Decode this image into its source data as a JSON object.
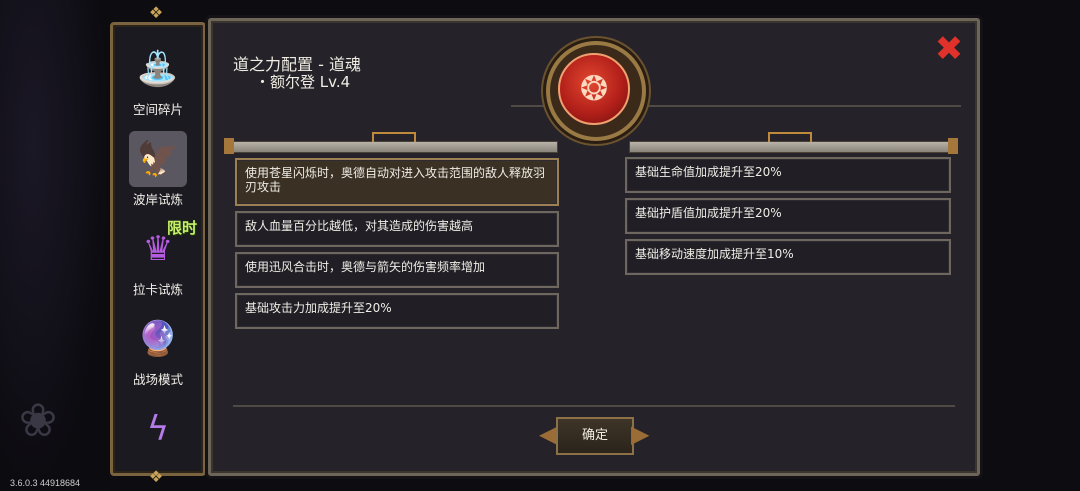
{
  "version": "3.6.0.3 44918684",
  "sidebar": {
    "items": [
      {
        "label": "空间碎片",
        "icon": "space-fragment-icon",
        "glyph": "⛲",
        "color": "#c9d4e8"
      },
      {
        "label": "波岸试炼",
        "icon": "winged-bird-icon",
        "glyph": "🦅",
        "color": "#e24a30"
      },
      {
        "label": "拉卡试炼",
        "icon": "purple-crown-icon",
        "glyph": "♛",
        "color": "#b55be0",
        "badge": "限时"
      },
      {
        "label": "战场模式",
        "icon": "wizard-icon",
        "glyph": "🔮",
        "color": "#8b5de8"
      },
      {
        "label": "",
        "icon": "lightning-icon",
        "glyph": "ϟ",
        "color": "#b47ae8"
      }
    ]
  },
  "panel": {
    "title": "道之力配置 - 道魂",
    "subtitle": "・额尔登 Lv.4",
    "emblem_glyph": "❂",
    "close_glyph": "✖",
    "confirm_label": "确定",
    "left_cards": [
      "使用苍星闪烁时，奥德自动对进入攻击范围的敌人释放羽刃攻击",
      "敌人血量百分比越低，对其造成的伤害越高",
      "使用迅风合击时，奥德与箭矢的伤害频率增加",
      "基础攻击力加成提升至20%"
    ],
    "right_cards": [
      "基础生命值加成提升至20%",
      "基础护盾值加成提升至20%",
      "基础移动速度加成提升至10%"
    ]
  },
  "colors": {
    "accent_gold": "#9c7f52",
    "close_red": "#e0322a",
    "emblem_red": "#b3201a",
    "badge_green": "#c8ee6a"
  }
}
